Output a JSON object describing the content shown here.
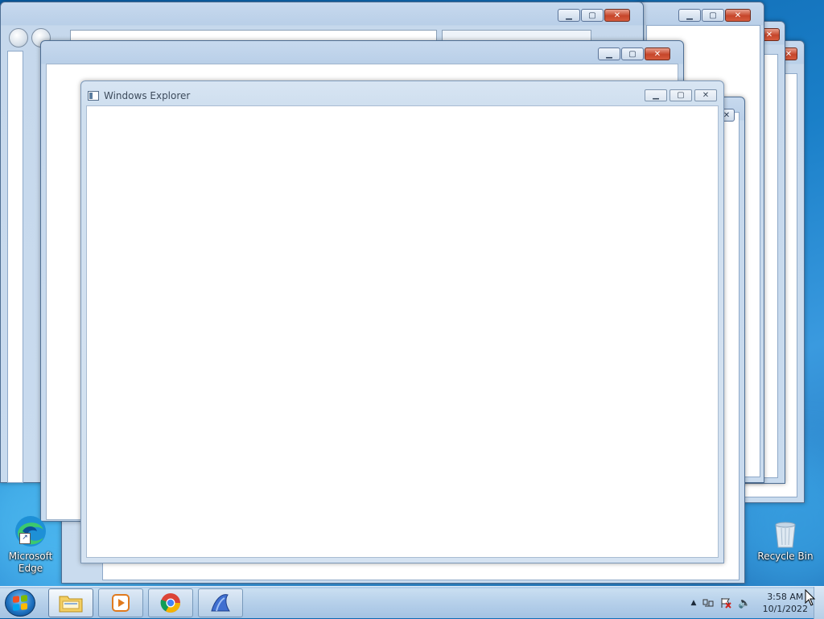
{
  "front_window": {
    "title": "Windows Explorer"
  },
  "desktop_icons": [
    {
      "label_line1": "Microsoft",
      "label_line2": "Edge"
    },
    {
      "label": "Recycle Bin"
    }
  ],
  "clock": {
    "time": "3:58 AM",
    "date": "10/1/2022"
  },
  "icons": {
    "minimize": "minimize-icon",
    "maximize": "maximize-icon",
    "close": "close-icon",
    "tray_overflow": "chevron-up-icon",
    "network": "network-icon",
    "action_center": "flag-icon",
    "volume": "speaker-icon"
  },
  "colors": {
    "desktop": "#1a7fc8",
    "close_button": "#c6452a",
    "taskbar": "#b6d0ea"
  }
}
